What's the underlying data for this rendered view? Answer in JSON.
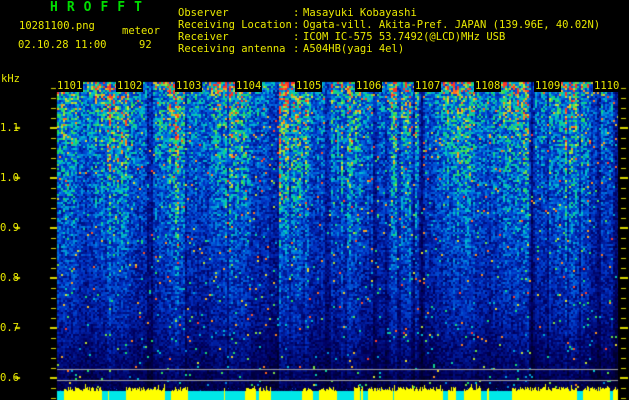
{
  "header": {
    "title": "HROFFT",
    "filename": "10281100.png",
    "mode": "meteor",
    "datetime": "02.10.28 11:00",
    "count": "92",
    "separator": ":",
    "info": [
      {
        "label": "Observer",
        "value": "Masayuki Kobayashi"
      },
      {
        "label": "Receiving Location",
        "value": "Ogata-vill. Akita-Pref. JAPAN (139.96E, 40.02N)"
      },
      {
        "label": "Receiver",
        "value": "ICOM IC-575 53.7492(@LCD)MHz USB"
      },
      {
        "label": "Receiving antenna",
        "value": "A504HB(yagi 4el)"
      }
    ]
  },
  "plot": {
    "unit_label": "kHz",
    "y_tick_labels": [
      "1.1",
      "1.0",
      "0.9",
      "0.8",
      "0.7",
      "0.6"
    ],
    "x_tick_labels": [
      "1101",
      "1102",
      "1103",
      "1104",
      "1105",
      "1106",
      "1107",
      "1108",
      "1109",
      "1110"
    ],
    "colors": {
      "title_green": "#00dd00",
      "text_yellow": "#e8e800",
      "tick_yellow": "#d8d800",
      "grid_gray": "#a0a0a0",
      "band_yellow": "#ffff00",
      "band_cyan": "#00e8e8"
    }
  },
  "chart_data": {
    "type": "heatmap",
    "title": "HROFFT radio meteor echo spectrogram",
    "x_axis": "time of day, minutes 11:01 through 11:10 on 2002.10.28",
    "x_tick_labels": [
      "1101",
      "1102",
      "1103",
      "1104",
      "1105",
      "1106",
      "1107",
      "1108",
      "1109",
      "1110"
    ],
    "ylabel": "kHz",
    "y_tick_values": [
      1.1,
      1.0,
      0.9,
      0.8,
      0.7,
      0.6
    ],
    "y_range_khz": [
      0.56,
      1.19
    ],
    "y_minor_tick_step_khz": 0.02,
    "meteor_count": 92,
    "legend_position": "none",
    "grid": "two horizontal gray reference lines near 0.62 and 0.60 kHz",
    "description": "Continuous broadband noise field: dense cyan/green speckle over blue near the top (higher frequencies) fading to dark navy/black toward the bottom, with sparse red/yellow hot pixels near the top, irregular dark vertical striations roughly every 30-60 px, and a yellow signal-level bar strip with cyan dropouts along the bottom edge"
  }
}
